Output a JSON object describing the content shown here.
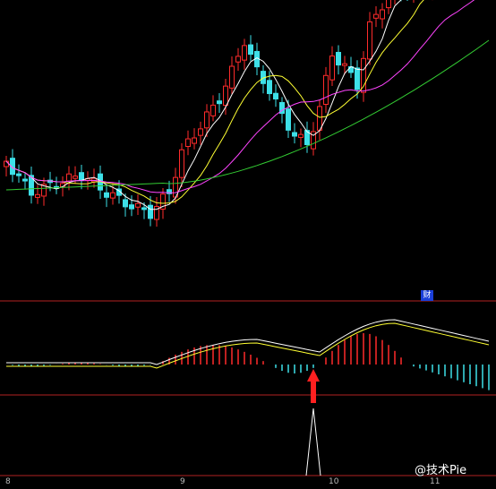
{
  "chart_data": {
    "type": "candlestick",
    "panels": [
      "price",
      "macd",
      "signal"
    ],
    "x_tick_labels": [
      {
        "label": "8",
        "index": 0
      },
      {
        "label": "9",
        "index": 30
      },
      {
        "label": "10",
        "index": 54
      },
      {
        "label": "11",
        "index": 70
      }
    ],
    "indicator_badge": "财",
    "colors": {
      "up": "#ff2b2b",
      "down": "#3de0e8",
      "ma_white": "#ffffff",
      "ma_yellow": "#ffff33",
      "ma_magenta": "#ff44ff",
      "ma_green": "#33cc33",
      "border": "#b22222"
    }
  },
  "watermark": "@技术Pie"
}
